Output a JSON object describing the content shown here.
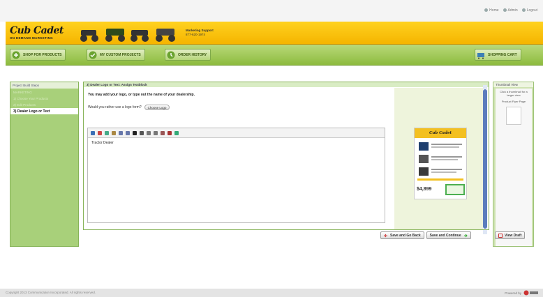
{
  "top_links": [
    "Home",
    "Admin",
    "Logout"
  ],
  "brand": {
    "logo": "Cub Cadet",
    "subtitle": "ON DEMAND MARKETING",
    "support_label": "Marketing Support",
    "support_phone": "877-620-1974"
  },
  "nav": {
    "shop": "SHOP FOR PRODUCTS",
    "projects": "MY CUSTOM PROJECTS",
    "orders": "ORDER HISTORY",
    "cart": "SHOPPING CART"
  },
  "sidebar": {
    "title": "Project Build Steps",
    "heading": "MARKETING",
    "items": [
      "1) Choose Your Products",
      "2) Edit Products",
      "3) Dealer Logo or Text"
    ]
  },
  "main": {
    "title": "3) Dealer Logo or Text: Assign Textblock",
    "intro": "You may add your logo, or type out the name of your dealership.",
    "ask": "Would you rather use a logo form?",
    "choose_label": "Choose Logo",
    "editor_text": "Tractor Dealer"
  },
  "preview": {
    "brand": "Cub Cadet",
    "price": "$4,899"
  },
  "thumbnail": {
    "title": "Thumbnail View",
    "hint": "Click a thumbnail for a larger view",
    "label": "Product Flyer Page"
  },
  "actions": {
    "save_back": "Save and Go Back",
    "save_continue": "Save and Continue",
    "view_draft": "View Draft"
  },
  "footer": {
    "copyright": "Copyright 2013 Communication Incorporated. All rights reserved.",
    "powered": "Powered by"
  },
  "colors": {
    "brand_yellow": "#f5b400",
    "nav_green": "#8dbb3e",
    "sidebar_green": "#a8d07a",
    "scroll_blue": "#5b7dbd"
  }
}
